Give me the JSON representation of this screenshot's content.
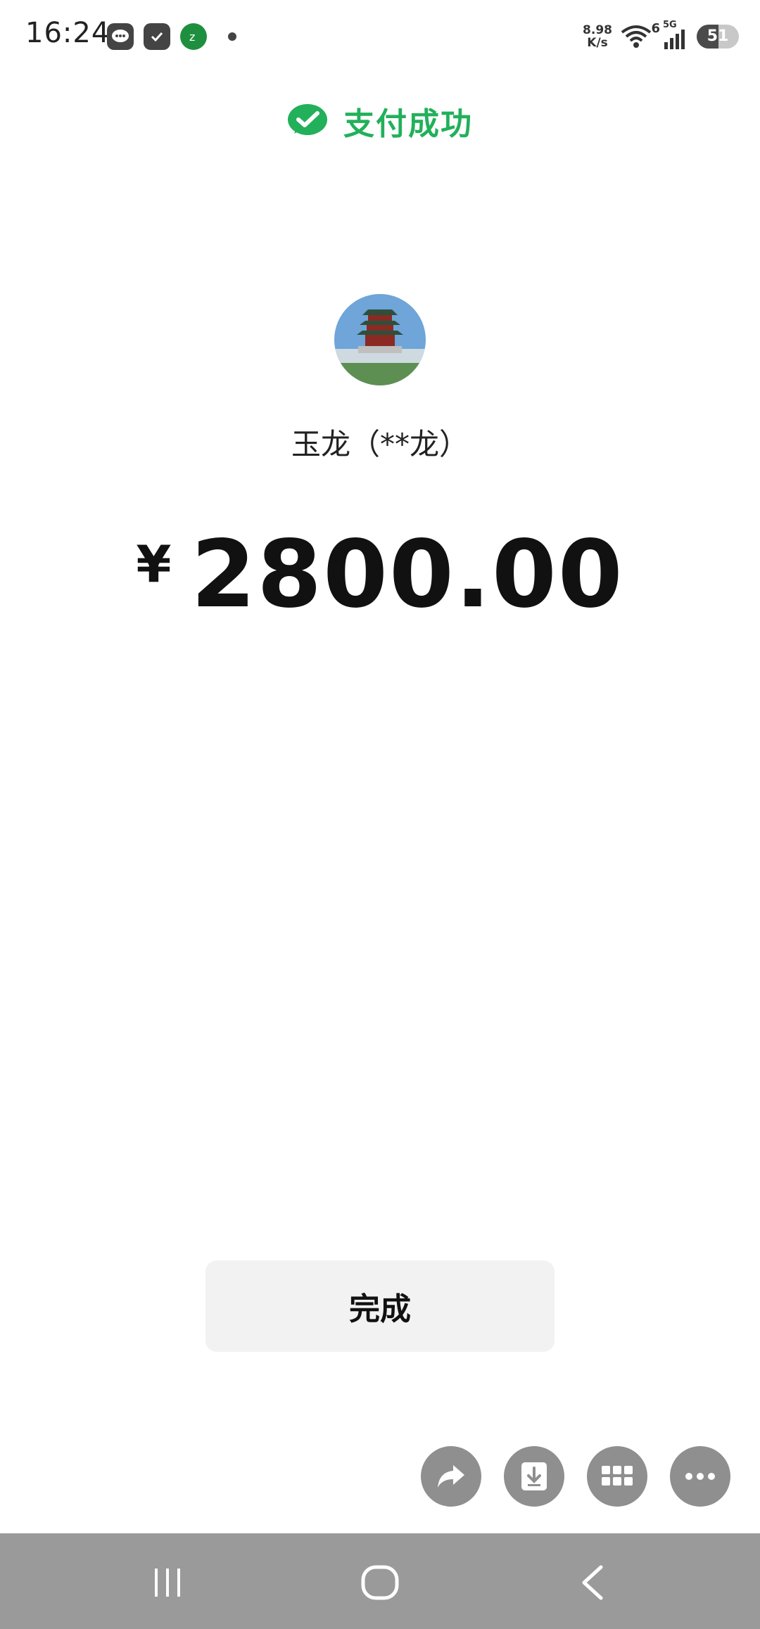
{
  "status_bar": {
    "time": "16:24",
    "net_speed_value": "8.98",
    "net_speed_unit": "K/s",
    "wifi_label": "6",
    "signal_label": "5G",
    "battery_level": "51",
    "battery_fraction": 0.51,
    "icons": [
      "message-icon",
      "task-icon",
      "app-badge-icon",
      "wifi-icon",
      "signal-icon"
    ]
  },
  "header": {
    "title": "支付成功",
    "accent": "#22b05a",
    "icon": "check-bubble-icon"
  },
  "payee": {
    "name": "玉龙（**龙）"
  },
  "payment": {
    "currency_symbol": "¥",
    "amount": "2800.00"
  },
  "actions": {
    "done_label": "完成",
    "floating": [
      "share-icon",
      "download-icon",
      "grid-icon",
      "more-icon"
    ]
  },
  "nav": {
    "buttons": [
      "recent-apps-icon",
      "home-icon",
      "back-icon"
    ]
  }
}
